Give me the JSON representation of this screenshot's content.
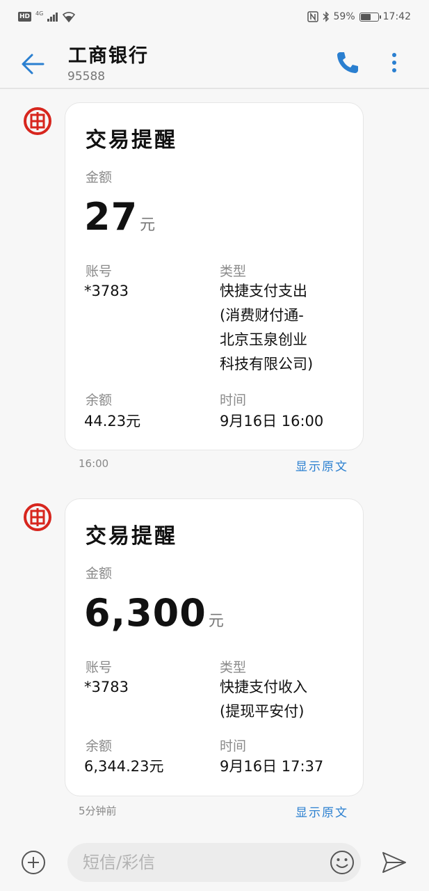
{
  "status_bar": {
    "hd": "HD",
    "network": "4G",
    "battery_percent": "59%",
    "battery_level": 0.59,
    "time": "17:42"
  },
  "header": {
    "title": "工商银行",
    "subtitle": "95588"
  },
  "messages": [
    {
      "title": "交易提醒",
      "amount_label": "金额",
      "amount": "27",
      "amount_unit": "元",
      "account_label": "账号",
      "account": "*3783",
      "type_label": "类型",
      "type_lines": [
        "快捷支付支出",
        "(消费财付通-",
        "北京玉泉创业",
        "科技有限公司)"
      ],
      "balance_label": "余额",
      "balance": "44.23元",
      "time_label": "时间",
      "time": "9月16日 16:00",
      "sent": "16:00",
      "show_original": "显示原文"
    },
    {
      "title": "交易提醒",
      "amount_label": "金额",
      "amount": "6,300",
      "amount_unit": "元",
      "account_label": "账号",
      "account": "*3783",
      "type_label": "类型",
      "type_lines": [
        "快捷支付收入",
        "(提现平安付)"
      ],
      "balance_label": "余额",
      "balance": "6,344.23元",
      "time_label": "时间",
      "time": "9月16日 17:37",
      "sent": "5分钟前",
      "show_original": "显示原文"
    }
  ],
  "composer": {
    "placeholder": "短信/彩信"
  },
  "colors": {
    "accent": "#2a7fd0",
    "icbc_red": "#d7261e"
  }
}
